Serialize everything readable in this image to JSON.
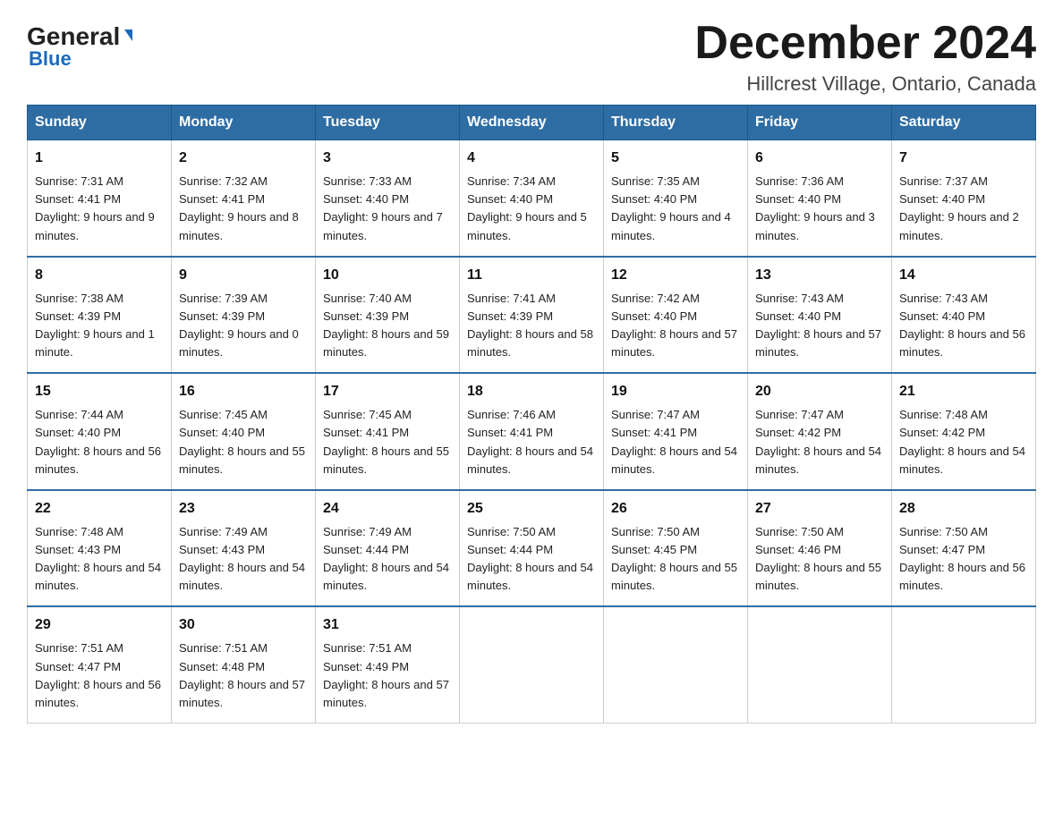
{
  "logo": {
    "general": "General",
    "triangle": "▶",
    "blue": "Blue"
  },
  "header": {
    "title": "December 2024",
    "subtitle": "Hillcrest Village, Ontario, Canada"
  },
  "weekdays": [
    "Sunday",
    "Monday",
    "Tuesday",
    "Wednesday",
    "Thursday",
    "Friday",
    "Saturday"
  ],
  "weeks": [
    [
      {
        "day": "1",
        "sunrise": "7:31 AM",
        "sunset": "4:41 PM",
        "daylight": "9 hours and 9 minutes."
      },
      {
        "day": "2",
        "sunrise": "7:32 AM",
        "sunset": "4:41 PM",
        "daylight": "9 hours and 8 minutes."
      },
      {
        "day": "3",
        "sunrise": "7:33 AM",
        "sunset": "4:40 PM",
        "daylight": "9 hours and 7 minutes."
      },
      {
        "day": "4",
        "sunrise": "7:34 AM",
        "sunset": "4:40 PM",
        "daylight": "9 hours and 5 minutes."
      },
      {
        "day": "5",
        "sunrise": "7:35 AM",
        "sunset": "4:40 PM",
        "daylight": "9 hours and 4 minutes."
      },
      {
        "day": "6",
        "sunrise": "7:36 AM",
        "sunset": "4:40 PM",
        "daylight": "9 hours and 3 minutes."
      },
      {
        "day": "7",
        "sunrise": "7:37 AM",
        "sunset": "4:40 PM",
        "daylight": "9 hours and 2 minutes."
      }
    ],
    [
      {
        "day": "8",
        "sunrise": "7:38 AM",
        "sunset": "4:39 PM",
        "daylight": "9 hours and 1 minute."
      },
      {
        "day": "9",
        "sunrise": "7:39 AM",
        "sunset": "4:39 PM",
        "daylight": "9 hours and 0 minutes."
      },
      {
        "day": "10",
        "sunrise": "7:40 AM",
        "sunset": "4:39 PM",
        "daylight": "8 hours and 59 minutes."
      },
      {
        "day": "11",
        "sunrise": "7:41 AM",
        "sunset": "4:39 PM",
        "daylight": "8 hours and 58 minutes."
      },
      {
        "day": "12",
        "sunrise": "7:42 AM",
        "sunset": "4:40 PM",
        "daylight": "8 hours and 57 minutes."
      },
      {
        "day": "13",
        "sunrise": "7:43 AM",
        "sunset": "4:40 PM",
        "daylight": "8 hours and 57 minutes."
      },
      {
        "day": "14",
        "sunrise": "7:43 AM",
        "sunset": "4:40 PM",
        "daylight": "8 hours and 56 minutes."
      }
    ],
    [
      {
        "day": "15",
        "sunrise": "7:44 AM",
        "sunset": "4:40 PM",
        "daylight": "8 hours and 56 minutes."
      },
      {
        "day": "16",
        "sunrise": "7:45 AM",
        "sunset": "4:40 PM",
        "daylight": "8 hours and 55 minutes."
      },
      {
        "day": "17",
        "sunrise": "7:45 AM",
        "sunset": "4:41 PM",
        "daylight": "8 hours and 55 minutes."
      },
      {
        "day": "18",
        "sunrise": "7:46 AM",
        "sunset": "4:41 PM",
        "daylight": "8 hours and 54 minutes."
      },
      {
        "day": "19",
        "sunrise": "7:47 AM",
        "sunset": "4:41 PM",
        "daylight": "8 hours and 54 minutes."
      },
      {
        "day": "20",
        "sunrise": "7:47 AM",
        "sunset": "4:42 PM",
        "daylight": "8 hours and 54 minutes."
      },
      {
        "day": "21",
        "sunrise": "7:48 AM",
        "sunset": "4:42 PM",
        "daylight": "8 hours and 54 minutes."
      }
    ],
    [
      {
        "day": "22",
        "sunrise": "7:48 AM",
        "sunset": "4:43 PM",
        "daylight": "8 hours and 54 minutes."
      },
      {
        "day": "23",
        "sunrise": "7:49 AM",
        "sunset": "4:43 PM",
        "daylight": "8 hours and 54 minutes."
      },
      {
        "day": "24",
        "sunrise": "7:49 AM",
        "sunset": "4:44 PM",
        "daylight": "8 hours and 54 minutes."
      },
      {
        "day": "25",
        "sunrise": "7:50 AM",
        "sunset": "4:44 PM",
        "daylight": "8 hours and 54 minutes."
      },
      {
        "day": "26",
        "sunrise": "7:50 AM",
        "sunset": "4:45 PM",
        "daylight": "8 hours and 55 minutes."
      },
      {
        "day": "27",
        "sunrise": "7:50 AM",
        "sunset": "4:46 PM",
        "daylight": "8 hours and 55 minutes."
      },
      {
        "day": "28",
        "sunrise": "7:50 AM",
        "sunset": "4:47 PM",
        "daylight": "8 hours and 56 minutes."
      }
    ],
    [
      {
        "day": "29",
        "sunrise": "7:51 AM",
        "sunset": "4:47 PM",
        "daylight": "8 hours and 56 minutes."
      },
      {
        "day": "30",
        "sunrise": "7:51 AM",
        "sunset": "4:48 PM",
        "daylight": "8 hours and 57 minutes."
      },
      {
        "day": "31",
        "sunrise": "7:51 AM",
        "sunset": "4:49 PM",
        "daylight": "8 hours and 57 minutes."
      },
      null,
      null,
      null,
      null
    ]
  ]
}
